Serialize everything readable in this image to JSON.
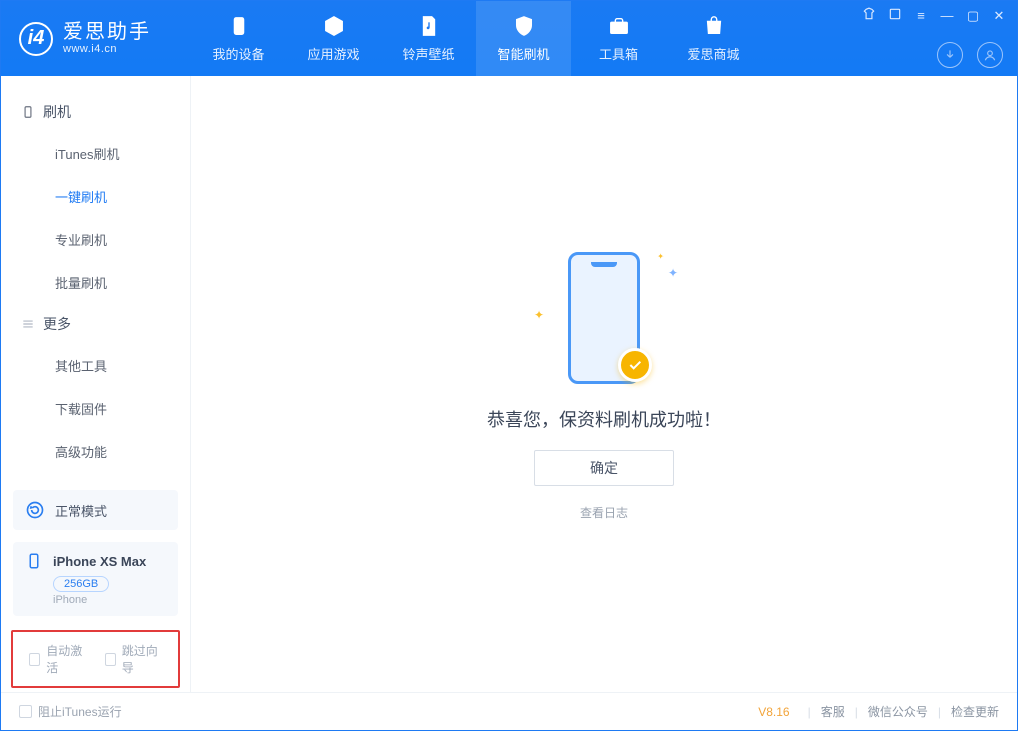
{
  "app": {
    "title": "爱思助手",
    "subtitle": "www.i4.cn"
  },
  "topnav": {
    "tabs": [
      {
        "label": "我的设备"
      },
      {
        "label": "应用游戏"
      },
      {
        "label": "铃声壁纸"
      },
      {
        "label": "智能刷机"
      },
      {
        "label": "工具箱"
      },
      {
        "label": "爱思商城"
      }
    ]
  },
  "sidebar": {
    "section1": {
      "title": "刷机",
      "items": [
        "iTunes刷机",
        "一键刷机",
        "专业刷机",
        "批量刷机"
      ]
    },
    "section2": {
      "title": "更多",
      "items": [
        "其他工具",
        "下载固件",
        "高级功能"
      ]
    },
    "mode_card": {
      "label": "正常模式"
    },
    "device_card": {
      "name": "iPhone XS Max",
      "capacity": "256GB",
      "type": "iPhone"
    },
    "checkboxes": {
      "auto_activate": "自动激活",
      "skip_guide": "跳过向导"
    }
  },
  "main": {
    "success_message": "恭喜您，保资料刷机成功啦！",
    "ok_button": "确定",
    "view_log": "查看日志"
  },
  "footer": {
    "block_itunes": "阻止iTunes运行",
    "version": "V8.16",
    "links": [
      "客服",
      "微信公众号",
      "检查更新"
    ]
  },
  "window_controls": {
    "settings": "⌂",
    "skin": "◫",
    "menu": "≡",
    "min": "—",
    "max": "▢",
    "close": "✕"
  }
}
